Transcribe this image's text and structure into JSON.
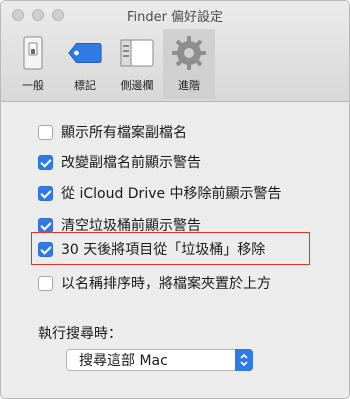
{
  "window": {
    "title": "Finder 偏好設定"
  },
  "toolbar": {
    "tabs": [
      {
        "label": "一般",
        "icon": "general-icon"
      },
      {
        "label": "標記",
        "icon": "tag-icon"
      },
      {
        "label": "側邊欄",
        "icon": "sidebar-icon"
      },
      {
        "label": "進階",
        "icon": "gear-icon",
        "selected": true
      }
    ]
  },
  "options": [
    {
      "label": "顯示所有檔案副檔名",
      "checked": false
    },
    {
      "label": "改變副檔名前顯示警告",
      "checked": true
    },
    {
      "label": "從 iCloud Drive 中移除前顯示警告",
      "checked": true
    },
    {
      "label": "清空垃圾桶前顯示警告",
      "checked": true
    },
    {
      "label": "30 天後將項目從「垃圾桶」移除",
      "checked": true,
      "highlighted": true
    },
    {
      "label": "以名稱排序時，將檔案夾置於上方",
      "checked": false
    }
  ],
  "search": {
    "label": "執行搜尋時：",
    "selected": "搜尋這部 Mac"
  },
  "colors": {
    "accent": "#2f7be2",
    "highlight": "#e0312b"
  }
}
